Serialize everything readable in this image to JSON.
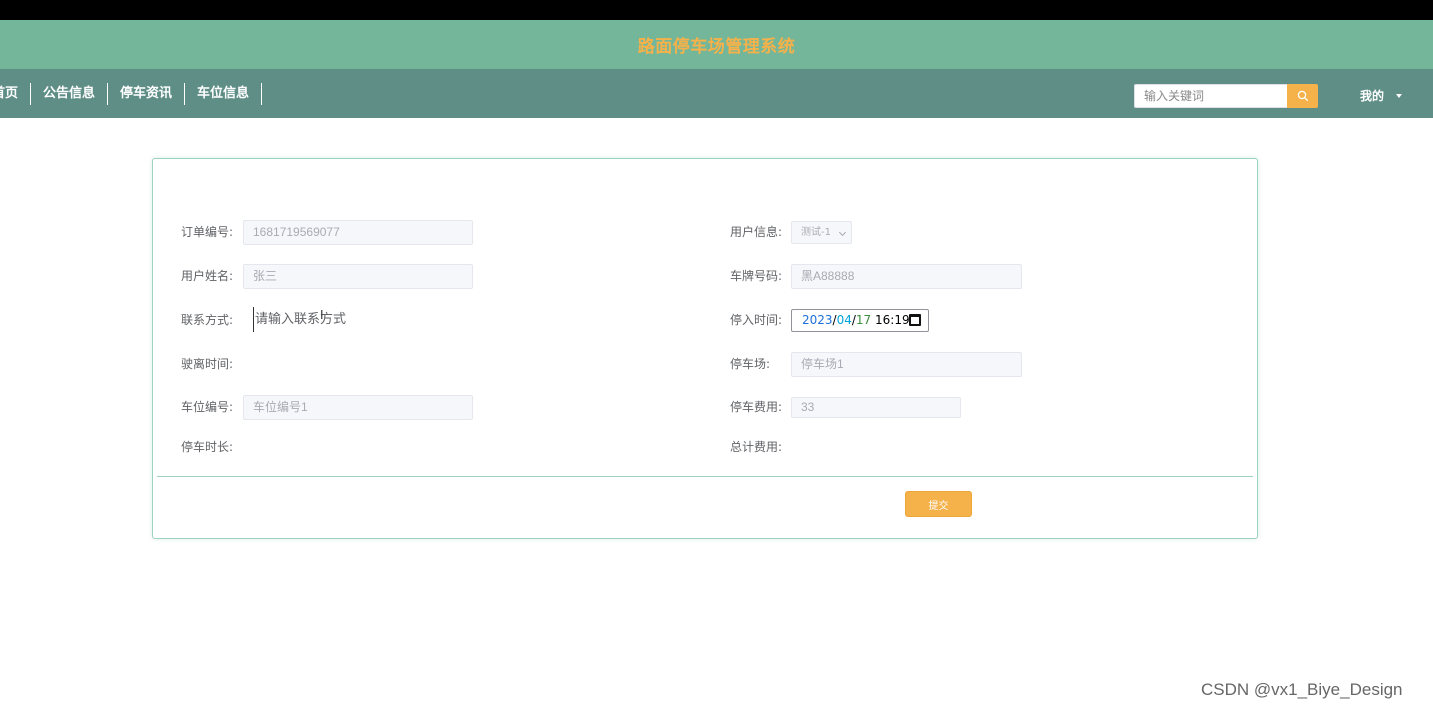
{
  "header": {
    "site_title": "路面停车场管理系统"
  },
  "nav": {
    "items": [
      {
        "label": "首页"
      },
      {
        "label": "公告信息"
      },
      {
        "label": "停车资讯"
      },
      {
        "label": "车位信息"
      }
    ],
    "search_placeholder": "输入关键词",
    "user_menu_label": "我的"
  },
  "form": {
    "order_no": {
      "label": "订单编号:",
      "value": "1681719569077"
    },
    "user_info": {
      "label": "用户信息:",
      "selected": "测试-1"
    },
    "user_name": {
      "label": "用户姓名:",
      "value": "张三"
    },
    "plate_no": {
      "label": "车牌号码:",
      "value": "黑A88888"
    },
    "phone": {
      "label": "联系方式:",
      "placeholder": "请输入联系方式"
    },
    "entry_time": {
      "label": "停入时间:",
      "year": "2023",
      "month": "04",
      "day": "17",
      "time": "16:19"
    },
    "leave_time": {
      "label": "驶离时间:"
    },
    "parking_lot": {
      "label": "停车场:",
      "value": "停车场1"
    },
    "space_no": {
      "label": "车位编号:",
      "value": "车位编号1"
    },
    "parking_fee": {
      "label": "停车费用:",
      "value": "33"
    },
    "duration": {
      "label": "停车时长:"
    },
    "total_fee": {
      "label": "总计费用:"
    },
    "submit_label": "提交"
  },
  "watermark": "CSDN @vx1_Biye_Design",
  "colors": {
    "title_bar": "#74b69a",
    "nav_bar": "#5e8e86",
    "accent": "#f5b14a",
    "card_border": "#9bd2c0"
  }
}
